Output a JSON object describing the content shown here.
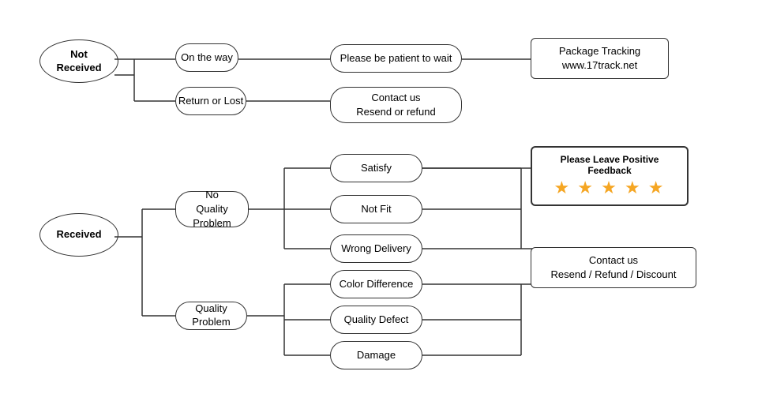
{
  "nodes": {
    "not_received": {
      "label": "Not\nReceived"
    },
    "on_the_way": {
      "label": "On the way"
    },
    "return_or_lost": {
      "label": "Return or Lost"
    },
    "patient": {
      "label": "Please be patient to wait"
    },
    "tracking": {
      "label": "Package Tracking\nwww.17track.net"
    },
    "contact_resend": {
      "label": "Contact us\nResend or refund"
    },
    "received": {
      "label": "Received"
    },
    "no_quality": {
      "label": "No\nQuality Problem"
    },
    "quality_problem": {
      "label": "Quality Problem"
    },
    "satisfy": {
      "label": "Satisfy"
    },
    "not_fit": {
      "label": "Not Fit"
    },
    "wrong_delivery": {
      "label": "Wrong Delivery"
    },
    "color_diff": {
      "label": "Color Difference"
    },
    "quality_defect": {
      "label": "Quality Defect"
    },
    "damage": {
      "label": "Damage"
    },
    "contact_refund": {
      "label": "Contact us\nResend / Refund / Discount"
    },
    "feedback": {
      "label": "Please Leave Positive Feedback"
    },
    "stars": {
      "value": "★ ★ ★ ★ ★"
    }
  }
}
